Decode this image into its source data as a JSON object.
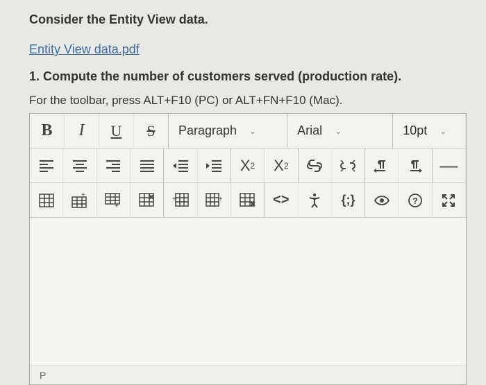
{
  "prompt": {
    "heading": "Consider the Entity View data.",
    "file_link": "Entity View data.pdf",
    "question": "1. Compute the number of customers served (production rate).",
    "toolbar_hint": "For the toolbar, press ALT+F10 (PC) or ALT+FN+F10 (Mac)."
  },
  "toolbar": {
    "bold": "B",
    "italic": "I",
    "underline": "U",
    "strike": "S",
    "paragraph_label": "Paragraph",
    "font_label": "Arial",
    "size_label": "10pt",
    "sup": "X",
    "sup_exp": "2",
    "sub": "X",
    "sub_idx": "2",
    "code": "<>",
    "css": "{;}",
    "dash": "—"
  },
  "status": {
    "path": "P"
  }
}
